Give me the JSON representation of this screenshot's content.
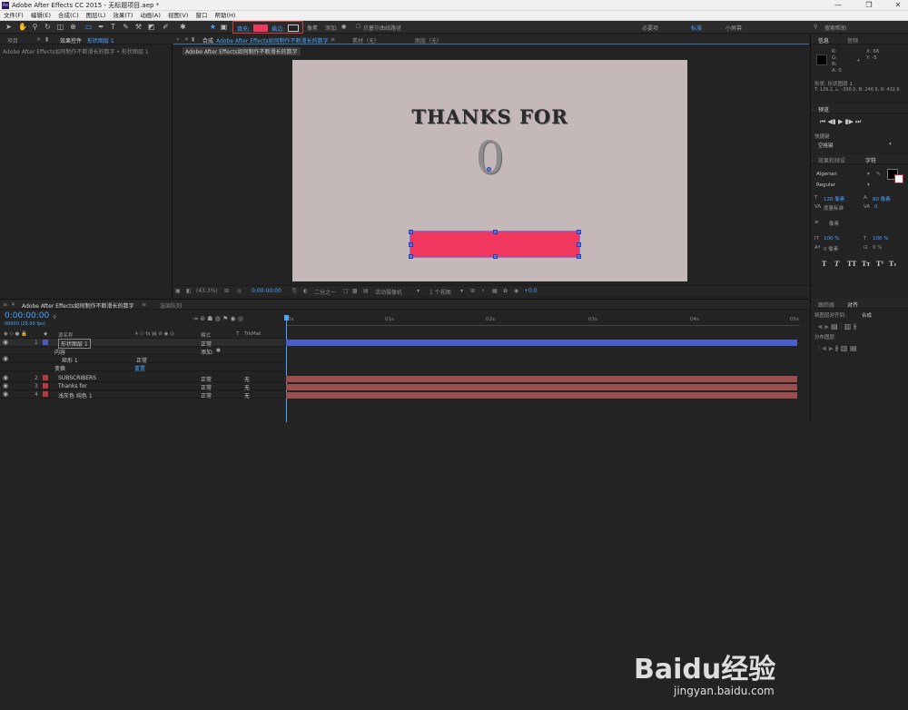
{
  "window": {
    "title": "Adobe After Effects CC 2015 - 无标题项目.aep *",
    "controls": [
      "—",
      "❐",
      "✕"
    ]
  },
  "menu": [
    "文件(F)",
    "编辑(E)",
    "合成(C)",
    "图层(L)",
    "效果(T)",
    "动画(A)",
    "视图(V)",
    "窗口",
    "帮助(H)"
  ],
  "toolbar": {
    "fill_label": "填充:",
    "stroke_label": "描边:",
    "px_label": "像素",
    "add_label": "添加:",
    "bezier_label": "贝塞尔曲线路径",
    "workspaces": [
      "必要项",
      "标准",
      "小屏幕"
    ],
    "active_workspace": "标准",
    "search_placeholder": "搜索帮助",
    "fill_color": "#f0385e"
  },
  "left_panel": {
    "tab_project": "项目",
    "tab_effects": "效果控件",
    "effects_target": "形状图层 1",
    "breadcrumb": "Adobe After Effects如何制作不断滑长的数字 • 形状图层 1"
  },
  "comp_panel": {
    "tab_comp_prefix": "合成",
    "tab_comp_name": "Adobe After Effects如何制作不断滑长的数字",
    "tab_material": "素材（无）",
    "tab_layer": "图层（无）",
    "tooltip": "Adobe After Effects如何制作不断滑长的数字",
    "canvas_bg": "#c4b8b8",
    "canvas_title": "THANKS FOR",
    "canvas_number": "0"
  },
  "comp_footer": {
    "zoom": "(43.3%)",
    "timecode": "0:00:00:00",
    "resolution": "二分之一",
    "camera": "活动摄像机",
    "views": "1 个视图",
    "exposure": "+0.0"
  },
  "info_panel": {
    "tab_info": "信息",
    "tab_audio": "音频",
    "r": "R:",
    "g": "G:",
    "b": "B:",
    "a": "A: 0",
    "x": "X: 66",
    "y": "Y: -5",
    "layer_line": "形状: 形状图层 1",
    "transform_line": "T: 129.2, L: -390.0, B: 246.9, R: 432.6"
  },
  "preview_panel": {
    "tab": "预览",
    "shortcut_label": "快捷键",
    "shortcut_value": "空格键"
  },
  "char_panel": {
    "tab_effects": "效果和预设",
    "tab_char": "字符",
    "font": "Algerian",
    "style": "Regular",
    "size": "120 像素",
    "leading": "80 像素",
    "kerning": "度量标准",
    "tracking": "0",
    "stroke": "像素",
    "vscale": "100 %",
    "hscale": "100 %",
    "baseline": "0 像素",
    "tsume": "0 %",
    "type_buttons": [
      "T",
      "T",
      "TT",
      "Tт",
      "T¹",
      "T₁"
    ]
  },
  "timeline": {
    "tab_render": "渲染队列",
    "comp_tab": "Adobe After Effects如何制作不断滑长的数字",
    "timecode": "0:00:00:00",
    "fps": "00000 (25.00 fps)",
    "search_placeholder": "",
    "col_name": "源名称",
    "col_mode": "模式",
    "col_t": "T",
    "col_trkmat": "TrkMat",
    "ruler_ticks": [
      "0s",
      "01s",
      "02s",
      "03s",
      "04s",
      "05s"
    ],
    "layers": [
      {
        "num": "1",
        "name": "形状图层 1",
        "mode": "正常",
        "trkmat": "",
        "color": "#4a5ab8",
        "bar": "#4a5dc8"
      },
      {
        "num": "",
        "name": "内容",
        "mode": "",
        "trkmat": "添加:",
        "color": "",
        "bar": ""
      },
      {
        "num": "",
        "name": "矩形 1",
        "mode": "正常",
        "trkmat": "",
        "color": "",
        "bar": ""
      },
      {
        "num": "",
        "name": "变换",
        "mode": "重置",
        "trkmat": "",
        "color": "",
        "bar": ""
      },
      {
        "num": "2",
        "name": "SUBSCRIBERS",
        "mode": "正常",
        "trkmat": "无",
        "color": "#b83a3a",
        "bar": "#9b4e4e"
      },
      {
        "num": "3",
        "name": "Thanks for",
        "mode": "正常",
        "trkmat": "无",
        "color": "#b83a3a",
        "bar": "#9b4e4e"
      },
      {
        "num": "4",
        "name": "浅灰色 纯色 1",
        "mode": "正常",
        "trkmat": "无",
        "color": "#b83a3a",
        "bar": "#9b4e4e"
      }
    ]
  },
  "right_bottom": {
    "tab_tracker": "跟踪器",
    "tab_align": "对齐",
    "align_to_label": "将图层对齐到:",
    "align_to_value": "合成",
    "distribute_label": "分布图层:"
  },
  "watermark": {
    "text": "Baidu经验",
    "url": "jingyan.baidu.com"
  }
}
